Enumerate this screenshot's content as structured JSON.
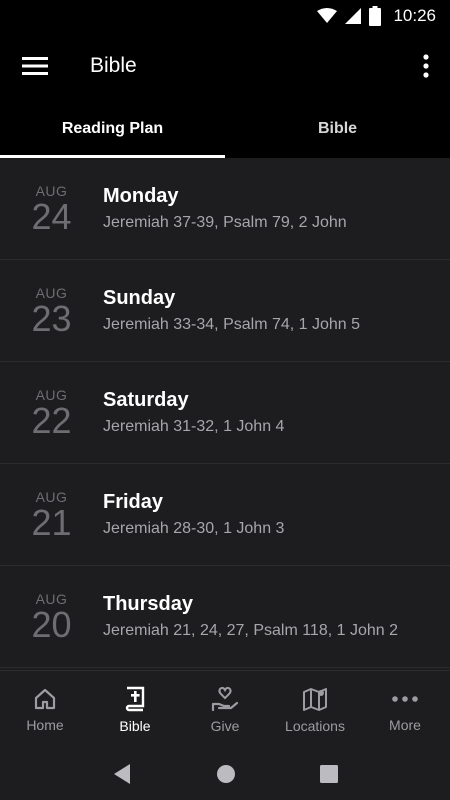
{
  "status_bar": {
    "time": "10:26"
  },
  "app_bar": {
    "title": "Bible"
  },
  "tabs": [
    {
      "label": "Reading Plan",
      "active": true
    },
    {
      "label": "Bible",
      "active": false
    }
  ],
  "readings": [
    {
      "month": "AUG",
      "day": "24",
      "weekday": "Monday",
      "passages": "Jeremiah 37-39, Psalm 79, 2 John"
    },
    {
      "month": "AUG",
      "day": "23",
      "weekday": "Sunday",
      "passages": "Jeremiah 33-34, Psalm 74, 1 John 5"
    },
    {
      "month": "AUG",
      "day": "22",
      "weekday": "Saturday",
      "passages": "Jeremiah 31-32, 1 John 4"
    },
    {
      "month": "AUG",
      "day": "21",
      "weekday": "Friday",
      "passages": "Jeremiah 28-30, 1 John 3"
    },
    {
      "month": "AUG",
      "day": "20",
      "weekday": "Thursday",
      "passages": "Jeremiah 21, 24, 27, Psalm 118, 1 John 2"
    }
  ],
  "bottom_nav": [
    {
      "label": "Home",
      "icon": "home-icon",
      "active": false
    },
    {
      "label": "Bible",
      "icon": "bible-icon",
      "active": true
    },
    {
      "label": "Give",
      "icon": "give-icon",
      "active": false
    },
    {
      "label": "Locations",
      "icon": "map-icon",
      "active": false
    },
    {
      "label": "More",
      "icon": "more-horizontal-icon",
      "active": false
    }
  ],
  "colors": {
    "background": "#000000",
    "list_background": "#1d1d1f",
    "active": "#ffffff",
    "inactive": "#9c9ca1"
  }
}
